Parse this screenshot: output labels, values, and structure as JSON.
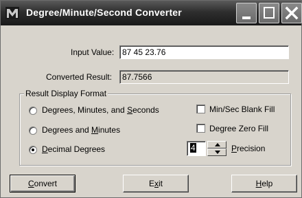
{
  "window": {
    "title": "Degree/Minute/Second Converter"
  },
  "titlebar_buttons": {
    "minimize_icon": "minimize-icon",
    "maximize_icon": "maximize-icon",
    "close_icon": "close-icon"
  },
  "input": {
    "label": "Input Value:",
    "value": "87 45 23.76"
  },
  "result": {
    "label": "Converted Result:",
    "value": "87.7566"
  },
  "format_group": {
    "legend": "Result Display Format",
    "options": [
      {
        "pre": "Degrees, Minutes, and ",
        "mnemonic": "S",
        "post": "econds",
        "selected": false
      },
      {
        "pre": "Degrees and ",
        "mnemonic": "M",
        "post": "inutes",
        "selected": false
      },
      {
        "pre": "",
        "mnemonic": "D",
        "post": "ecimal Degrees",
        "selected": true
      }
    ],
    "checkboxes": [
      {
        "label": "Min/Sec Blank Fill",
        "checked": false
      },
      {
        "label": "Degree Zero Fill",
        "checked": false
      }
    ],
    "precision": {
      "value": "4",
      "pre": "",
      "mnemonic": "P",
      "post": "recision"
    }
  },
  "buttons": {
    "convert": {
      "pre": "",
      "mnemonic": "C",
      "post": "onvert"
    },
    "exit": {
      "pre": "E",
      "mnemonic": "x",
      "post": "it"
    },
    "help": {
      "pre": "",
      "mnemonic": "H",
      "post": "elp"
    }
  },
  "colors": {
    "dialog_bg": "#d8d4cc",
    "titlebar": "#2e2e2e",
    "title_text": "#ffffff"
  }
}
